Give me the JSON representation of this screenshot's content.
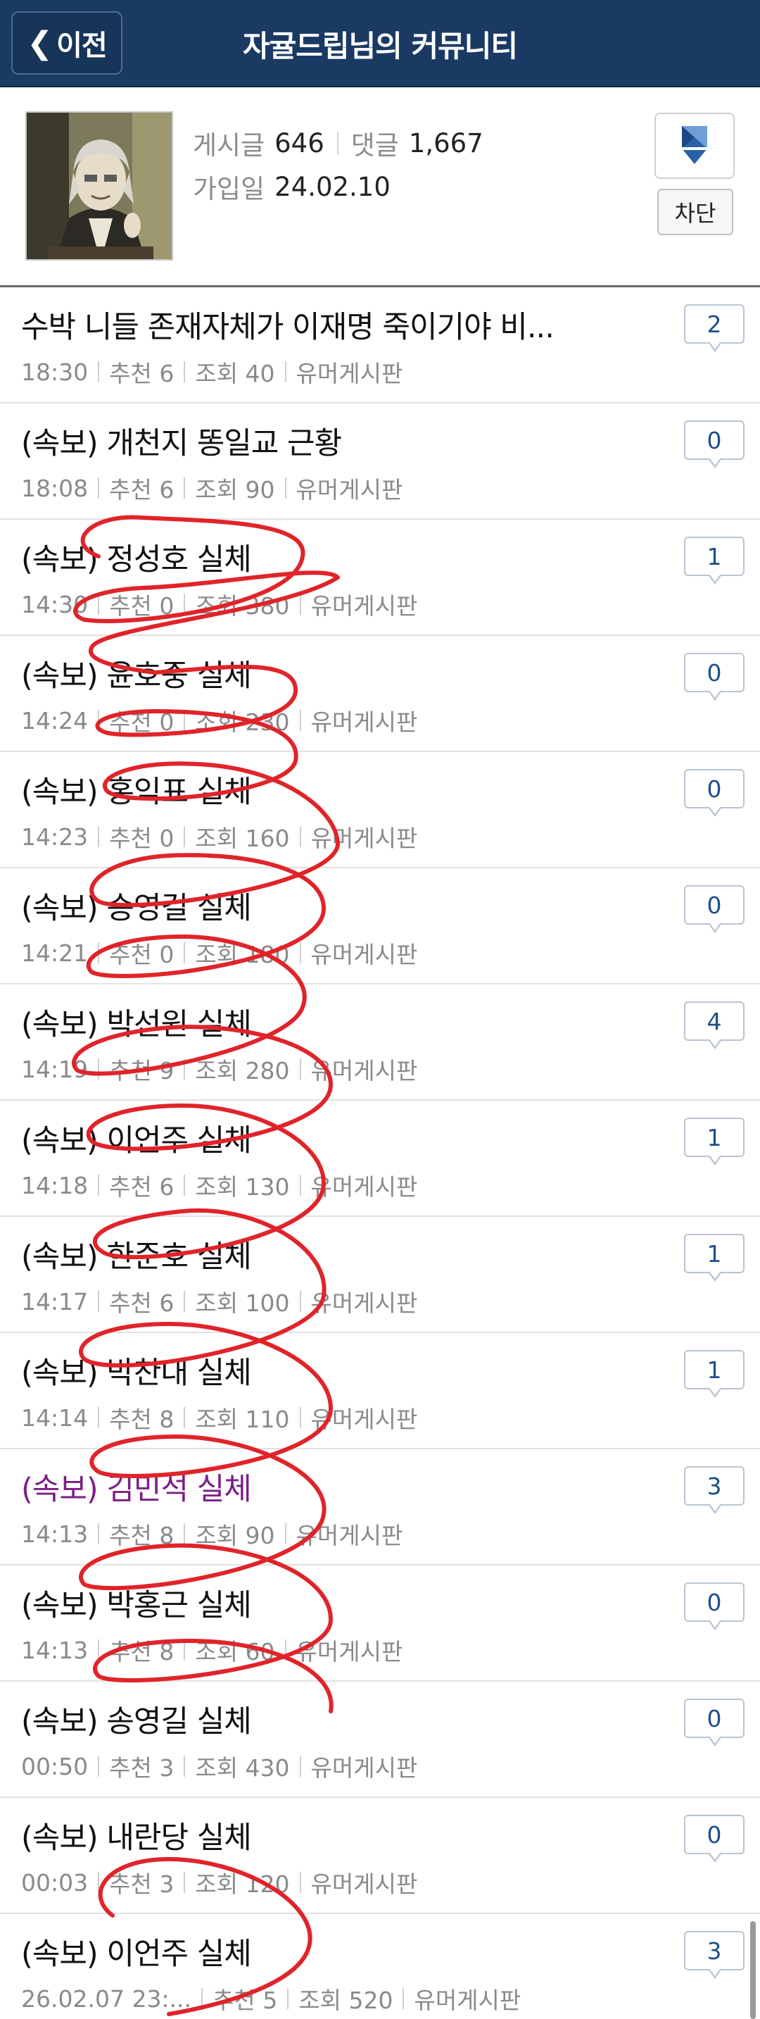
{
  "header": {
    "back_label": "이전",
    "title": "자귤드립님의 커뮤니티"
  },
  "profile": {
    "posts_label": "게시글",
    "posts_value": "646",
    "comments_label": "댓글",
    "comments_value": "1,667",
    "joined_label": "가입일",
    "joined_value": "24.02.10",
    "block_label": "차단",
    "badge_icon": "bookmark-shield-icon"
  },
  "posts": [
    {
      "title": "수박 니들 존재자체가 이재명 죽이기야 비...",
      "time": "18:30",
      "rec": "추천 6",
      "views": "조회 40",
      "board": "유머게시판",
      "comments": "2",
      "visited": false
    },
    {
      "title": "(속보) 개천지 똥일교 근황",
      "time": "18:08",
      "rec": "추천 6",
      "views": "조회 90",
      "board": "유머게시판",
      "comments": "0",
      "visited": false
    },
    {
      "title": "(속보) 정성호 실체",
      "time": "14:30",
      "rec": "추천 0",
      "views": "조회 380",
      "board": "유머게시판",
      "comments": "1",
      "visited": false
    },
    {
      "title": "(속보) 윤호중 실체",
      "time": "14:24",
      "rec": "추천 0",
      "views": "조회 230",
      "board": "유머게시판",
      "comments": "0",
      "visited": false
    },
    {
      "title": "(속보) 홍익표 실체",
      "time": "14:23",
      "rec": "추천 0",
      "views": "조회 160",
      "board": "유머게시판",
      "comments": "0",
      "visited": false
    },
    {
      "title": "(속보) 송영길 실체",
      "time": "14:21",
      "rec": "추천 0",
      "views": "조회 180",
      "board": "유머게시판",
      "comments": "0",
      "visited": false
    },
    {
      "title": "(속보) 박선원 실체",
      "time": "14:19",
      "rec": "추천 9",
      "views": "조회 280",
      "board": "유머게시판",
      "comments": "4",
      "visited": false
    },
    {
      "title": "(속보) 이언주 실체",
      "time": "14:18",
      "rec": "추천 6",
      "views": "조회 130",
      "board": "유머게시판",
      "comments": "1",
      "visited": false
    },
    {
      "title": "(속보) 한준호 실체",
      "time": "14:17",
      "rec": "추천 6",
      "views": "조회 100",
      "board": "유머게시판",
      "comments": "1",
      "visited": false
    },
    {
      "title": "(속보) 박찬대 실체",
      "time": "14:14",
      "rec": "추천 8",
      "views": "조회 110",
      "board": "유머게시판",
      "comments": "1",
      "visited": false
    },
    {
      "title": "(속보) 김민석 실체",
      "time": "14:13",
      "rec": "추천 8",
      "views": "조회 90",
      "board": "유머게시판",
      "comments": "3",
      "visited": true
    },
    {
      "title": "(속보) 박홍근 실체",
      "time": "14:13",
      "rec": "추천 8",
      "views": "조회 60",
      "board": "유머게시판",
      "comments": "0",
      "visited": false
    },
    {
      "title": "(속보) 송영길 실체",
      "time": "00:50",
      "rec": "추천 3",
      "views": "조회 430",
      "board": "유머게시판",
      "comments": "0",
      "visited": false
    },
    {
      "title": "(속보) 내란당 실체",
      "time": "00:03",
      "rec": "추천 3",
      "views": "조회 120",
      "board": "유머게시판",
      "comments": "0",
      "visited": false
    },
    {
      "title": "(속보) 이언주 실체",
      "time": "26.02.07 23:...",
      "rec": "추천 5",
      "views": "조회 520",
      "board": "유머게시판",
      "comments": "3",
      "visited": false
    }
  ]
}
